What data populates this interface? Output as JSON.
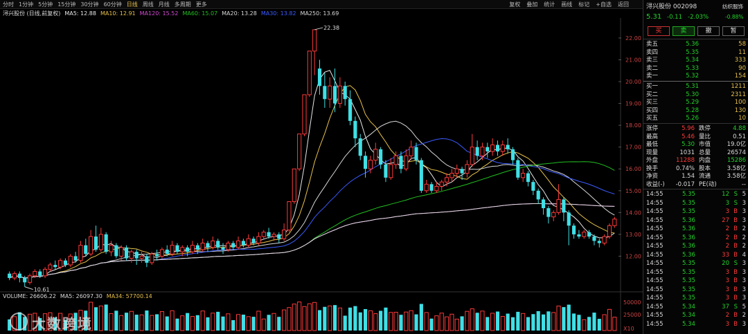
{
  "toolbar": {
    "tabs": [
      "分时",
      "1分钟",
      "5分钟",
      "15分钟",
      "30分钟",
      "60分钟",
      "日线",
      "周线",
      "月线",
      "多周期",
      "更多"
    ],
    "active_tab": "日线",
    "tools": [
      "复权",
      "叠加",
      "统计",
      "画线",
      "标记",
      "+自选",
      "返回"
    ]
  },
  "legend": {
    "stock": "浔兴股份 (日线,前复权)",
    "ma": [
      {
        "label": "MA5: 12.88",
        "color": "#e8e8e8"
      },
      {
        "label": "MA10: 12.91",
        "color": "#e8c14a"
      },
      {
        "label": "MA120: 15.52",
        "color": "#d24ad2"
      },
      {
        "label": "MA60: 15.07",
        "color": "#22c022"
      },
      {
        "label": "MA20: 13.28",
        "color": "#d8d8d8"
      },
      {
        "label": "MA30: 13.82",
        "color": "#3b5bff"
      },
      {
        "label": "MA250: 13.69",
        "color": "#d8d8d8"
      }
    ]
  },
  "volume_legend": [
    {
      "label": "VOLUME: 26606.22",
      "color": "#dcdcdc"
    },
    {
      "label": "MA5: 26097.30",
      "color": "#dcdcdc"
    },
    {
      "label": "MA34: 57700.14",
      "color": "#e8c14a"
    }
  ],
  "watermark": "大数跨境",
  "chart_data": {
    "type": "candlestick",
    "y_ticks": [
      22.0,
      21.0,
      20.0,
      19.0,
      18.0,
      17.0,
      16.0,
      15.0,
      14.0,
      13.0,
      12.0
    ],
    "volume_ticks": [
      "50000",
      "25000",
      "X10"
    ],
    "high_label": "22.38",
    "low_label": "10.61",
    "ylim": [
      11.0,
      22.6
    ],
    "candles": [
      [
        11.2,
        11.0,
        11.3,
        10.9
      ],
      [
        11.0,
        11.2,
        11.3,
        10.9
      ],
      [
        11.2,
        11.0,
        11.3,
        10.8
      ],
      [
        11.0,
        10.8,
        11.1,
        10.6
      ],
      [
        10.8,
        11.1,
        11.2,
        10.7
      ],
      [
        11.1,
        11.3,
        11.4,
        11.0
      ],
      [
        11.3,
        11.1,
        11.4,
        11.0
      ],
      [
        11.1,
        11.4,
        11.5,
        11.0
      ],
      [
        11.4,
        11.6,
        11.7,
        11.3
      ],
      [
        11.6,
        11.5,
        11.8,
        11.4
      ],
      [
        11.5,
        11.8,
        11.9,
        11.4
      ],
      [
        11.8,
        11.6,
        11.9,
        11.5
      ],
      [
        11.6,
        12.0,
        12.1,
        11.5
      ],
      [
        12.0,
        11.8,
        12.2,
        11.7
      ],
      [
        11.8,
        12.5,
        12.7,
        11.7
      ],
      [
        12.5,
        12.1,
        12.8,
        12.0
      ],
      [
        12.1,
        12.9,
        13.2,
        12.0
      ],
      [
        12.9,
        12.3,
        13.4,
        12.2
      ],
      [
        12.3,
        13.0,
        13.3,
        12.2
      ],
      [
        13.0,
        12.2,
        13.1,
        12.1
      ],
      [
        12.2,
        12.5,
        12.7,
        12.0
      ],
      [
        12.5,
        12.0,
        12.6,
        11.9
      ],
      [
        12.0,
        12.4,
        12.5,
        11.8
      ],
      [
        12.4,
        11.9,
        12.5,
        11.8
      ],
      [
        11.9,
        12.2,
        12.3,
        11.7
      ],
      [
        12.2,
        11.9,
        12.3,
        11.6
      ],
      [
        11.9,
        12.0,
        12.2,
        11.7
      ],
      [
        12.0,
        11.7,
        12.1,
        11.5
      ],
      [
        11.7,
        12.1,
        12.2,
        11.6
      ],
      [
        12.1,
        12.0,
        12.3,
        11.8
      ],
      [
        12.0,
        12.3,
        12.4,
        11.9
      ],
      [
        12.3,
        12.1,
        12.5,
        12.0
      ],
      [
        12.1,
        12.5,
        12.7,
        12.0
      ],
      [
        12.5,
        12.2,
        12.6,
        12.1
      ],
      [
        12.2,
        12.4,
        12.5,
        12.0
      ],
      [
        12.4,
        12.2,
        12.5,
        12.0
      ],
      [
        12.2,
        12.5,
        12.7,
        12.1
      ],
      [
        12.5,
        12.3,
        12.6,
        12.1
      ],
      [
        12.3,
        12.6,
        12.8,
        12.2
      ],
      [
        12.6,
        12.4,
        12.7,
        12.2
      ],
      [
        12.4,
        12.7,
        12.9,
        12.3
      ],
      [
        12.7,
        12.4,
        12.8,
        12.3
      ],
      [
        12.4,
        12.3,
        12.6,
        12.1
      ],
      [
        12.3,
        12.6,
        12.7,
        12.2
      ],
      [
        12.6,
        12.4,
        12.7,
        12.3
      ],
      [
        12.4,
        12.7,
        12.9,
        12.3
      ],
      [
        12.7,
        12.5,
        12.8,
        12.4
      ],
      [
        12.5,
        12.8,
        13.0,
        12.4
      ],
      [
        12.8,
        12.6,
        12.9,
        12.5
      ],
      [
        12.6,
        12.9,
        13.1,
        12.5
      ],
      [
        12.9,
        13.1,
        13.2,
        12.8
      ],
      [
        13.1,
        12.9,
        13.3,
        12.8
      ],
      [
        12.9,
        13.0,
        13.1,
        12.7
      ],
      [
        13.0,
        12.8,
        13.1,
        12.6
      ],
      [
        12.8,
        13.2,
        13.5,
        12.7
      ],
      [
        13.2,
        14.5,
        14.5,
        13.1
      ],
      [
        14.5,
        16.0,
        16.0,
        14.4
      ],
      [
        16.0,
        17.6,
        17.6,
        15.9
      ],
      [
        17.6,
        19.4,
        19.4,
        17.5
      ],
      [
        19.4,
        21.4,
        21.4,
        19.3
      ],
      [
        21.4,
        22.38,
        22.38,
        20.3
      ],
      [
        20.6,
        19.8,
        21.0,
        19.4
      ],
      [
        19.8,
        19.2,
        20.4,
        18.8
      ],
      [
        19.2,
        19.8,
        20.2,
        18.8
      ],
      [
        19.8,
        19.0,
        20.6,
        18.6
      ],
      [
        19.0,
        19.8,
        20.2,
        18.8
      ],
      [
        19.8,
        19.2,
        20.0,
        18.9
      ],
      [
        19.2,
        18.2,
        19.6,
        18.0
      ],
      [
        18.2,
        17.4,
        18.4,
        17.0
      ],
      [
        17.4,
        16.6,
        17.6,
        16.4
      ],
      [
        16.6,
        16.0,
        16.8,
        15.6
      ],
      [
        16.0,
        16.4,
        16.6,
        15.8
      ],
      [
        16.4,
        16.9,
        17.2,
        16.2
      ],
      [
        16.9,
        16.2,
        17.0,
        16.0
      ],
      [
        16.2,
        15.6,
        16.4,
        15.4
      ],
      [
        15.6,
        16.2,
        16.5,
        15.5
      ],
      [
        16.2,
        16.6,
        16.8,
        16.0
      ],
      [
        16.6,
        16.0,
        16.8,
        15.8
      ],
      [
        16.0,
        16.6,
        16.9,
        15.9
      ],
      [
        16.6,
        17.0,
        17.3,
        16.4
      ],
      [
        17.0,
        16.4,
        17.2,
        16.2
      ],
      [
        16.4,
        15.0,
        16.5,
        14.9
      ],
      [
        15.0,
        15.3,
        15.5,
        14.9
      ],
      [
        15.3,
        15.0,
        15.4,
        14.9
      ],
      [
        15.0,
        15.2,
        15.4,
        14.9
      ],
      [
        15.2,
        15.4,
        15.5,
        15.0
      ],
      [
        15.4,
        15.6,
        15.8,
        15.2
      ],
      [
        15.6,
        15.8,
        16.0,
        15.4
      ],
      [
        15.8,
        16.0,
        16.2,
        15.6
      ],
      [
        16.0,
        15.8,
        16.1,
        15.5
      ],
      [
        15.8,
        16.2,
        16.4,
        15.6
      ],
      [
        16.2,
        17.0,
        17.6,
        16.1
      ],
      [
        17.0,
        16.6,
        17.3,
        16.4
      ],
      [
        16.6,
        17.0,
        17.2,
        16.4
      ],
      [
        17.0,
        16.8,
        17.2,
        16.5
      ],
      [
        16.8,
        17.1,
        17.4,
        16.6
      ],
      [
        17.1,
        16.8,
        17.3,
        16.6
      ],
      [
        16.8,
        17.1,
        17.3,
        16.6
      ],
      [
        17.1,
        16.9,
        17.4,
        16.7
      ],
      [
        16.9,
        16.4,
        17.0,
        16.2
      ],
      [
        16.4,
        15.6,
        16.5,
        15.5
      ],
      [
        15.6,
        15.8,
        16.0,
        15.4
      ],
      [
        15.8,
        15.4,
        15.9,
        15.2
      ],
      [
        15.4,
        15.0,
        15.5,
        14.8
      ],
      [
        15.0,
        14.6,
        15.1,
        14.4
      ],
      [
        14.6,
        14.2,
        14.7,
        13.9
      ],
      [
        14.2,
        13.8,
        14.3,
        13.5
      ],
      [
        13.8,
        14.0,
        14.1,
        13.6
      ],
      [
        14.0,
        14.6,
        15.3,
        13.9
      ],
      [
        14.6,
        14.0,
        14.7,
        13.6
      ],
      [
        14.0,
        13.4,
        14.1,
        12.5
      ],
      [
        13.4,
        13.0,
        13.5,
        12.8
      ],
      [
        13.0,
        12.9,
        13.2,
        12.8
      ],
      [
        12.9,
        13.1,
        13.2,
        12.8
      ],
      [
        13.1,
        12.9,
        13.2,
        12.8
      ],
      [
        12.9,
        12.7,
        13.0,
        12.5
      ],
      [
        12.7,
        12.6,
        12.8,
        12.4
      ],
      [
        12.6,
        12.9,
        13.0,
        12.5
      ],
      [
        12.9,
        13.4,
        13.5,
        12.8
      ],
      [
        13.4,
        13.7,
        13.8,
        13.3
      ]
    ]
  },
  "panel": {
    "title": "浔兴股份 002098",
    "tag": "纺织服饰",
    "price": "5.31",
    "change": "-0.11",
    "pct": "-2.03%",
    "sector_pct": "-0.88%",
    "buttons": [
      "买",
      "卖",
      "撤",
      "暂"
    ],
    "asks": [
      [
        "卖五",
        "5.36",
        "58"
      ],
      [
        "卖四",
        "5.35",
        "11"
      ],
      [
        "卖三",
        "5.34",
        "333"
      ],
      [
        "卖二",
        "5.33",
        "90"
      ],
      [
        "卖一",
        "5.32",
        "154"
      ]
    ],
    "bids": [
      [
        "买一",
        "5.31",
        "1211"
      ],
      [
        "买二",
        "5.30",
        "2311"
      ],
      [
        "买三",
        "5.29",
        "100"
      ],
      [
        "买四",
        "5.28",
        "130"
      ],
      [
        "买五",
        "5.26",
        "10"
      ]
    ],
    "stats": [
      [
        "涨停",
        "5.96",
        "跌停",
        "4.88"
      ],
      [
        "最高",
        "5.46",
        "量比",
        "0.51"
      ],
      [
        "最低",
        "5.30",
        "市值",
        "19.0亿"
      ],
      [
        "现量",
        "1031",
        "总量",
        "26574"
      ],
      [
        "外盘",
        "11288",
        "内盘",
        "15286"
      ],
      [
        "换手",
        "0.74%",
        "股本",
        "3.58亿"
      ],
      [
        "净资",
        "1.54",
        "流通",
        "3.58亿"
      ],
      [
        "收益(-)",
        "-0.017",
        "PE(动)",
        "--"
      ]
    ],
    "ticks": [
      [
        "14:55",
        "5.35",
        "12",
        "S",
        "5"
      ],
      [
        "14:55",
        "5.35",
        "3",
        "S",
        "3"
      ],
      [
        "14:55",
        "5.35",
        "3",
        "B",
        "3"
      ],
      [
        "14:55",
        "5.36",
        "27",
        "B",
        "3"
      ],
      [
        "14:55",
        "5.36",
        "2",
        "B",
        "2"
      ],
      [
        "14:55",
        "5.36",
        "2",
        "B",
        "2"
      ],
      [
        "14:55",
        "5.36",
        "2",
        "B",
        "2"
      ],
      [
        "14:55",
        "5.36",
        "33",
        "B",
        "4"
      ],
      [
        "14:55",
        "5.35",
        "20",
        "S",
        "3"
      ],
      [
        "14:55",
        "5.35",
        "3",
        "B",
        "3"
      ],
      [
        "14:55",
        "5.35",
        "3",
        "B",
        "3"
      ],
      [
        "14:55",
        "5.35",
        "3",
        "B",
        "3"
      ],
      [
        "14:55",
        "5.35",
        "3",
        "B",
        "3"
      ],
      [
        "14:55",
        "5.34",
        "37",
        "S",
        "5"
      ],
      [
        "14:55",
        "5.34",
        "2",
        "B",
        "2"
      ],
      [
        "14:55",
        "5.34",
        "3",
        "B",
        "3"
      ]
    ]
  }
}
